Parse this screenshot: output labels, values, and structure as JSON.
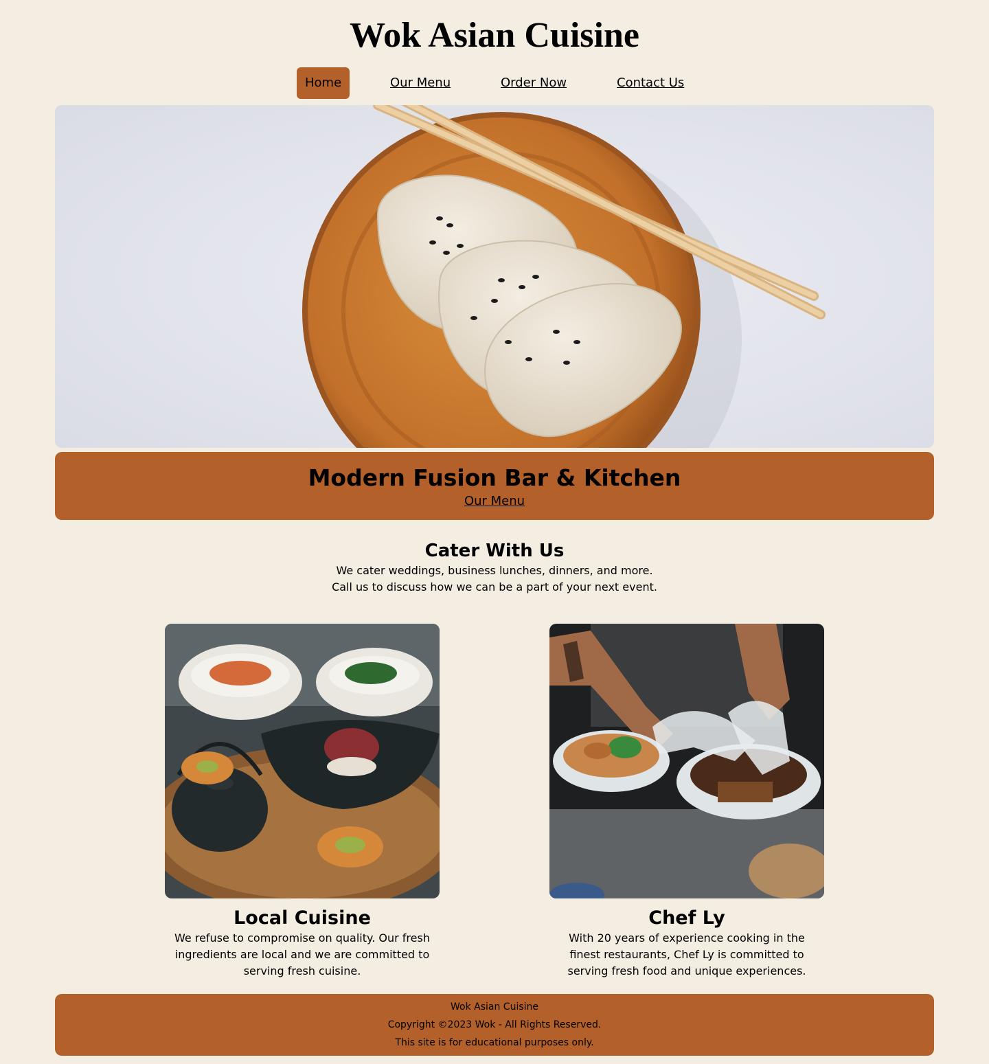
{
  "site": {
    "title": "Wok Asian Cuisine"
  },
  "nav": {
    "items": [
      {
        "label": "Home"
      },
      {
        "label": "Our Menu"
      },
      {
        "label": "Order Now"
      },
      {
        "label": "Contact Us"
      }
    ],
    "active_index": 0
  },
  "banner": {
    "title": "Modern Fusion Bar & Kitchen",
    "link_label": "Our Menu"
  },
  "cater": {
    "title": "Cater With Us",
    "line1": "We cater weddings, business lunches, dinners, and more.",
    "line2": "Call us to discuss how we can be a part of your next event."
  },
  "cards": [
    {
      "title": "Local Cuisine",
      "text": "We refuse to compromise on quality. Our fresh ingredients are local and we are committed to serving fresh cuisine."
    },
    {
      "title": "Chef Ly",
      "text": "With 20 years of experience cooking in the finest restaurants, Chef Ly is committed to serving fresh food and unique experiences."
    }
  ],
  "footer": {
    "line1": "Wok Asian Cuisine",
    "line2": "Copyright ©2023 Wok - All Rights Reserved.",
    "line3": "This site is for educational purposes only."
  },
  "colors": {
    "background": "#f4ede1",
    "accent": "#b4602a"
  }
}
